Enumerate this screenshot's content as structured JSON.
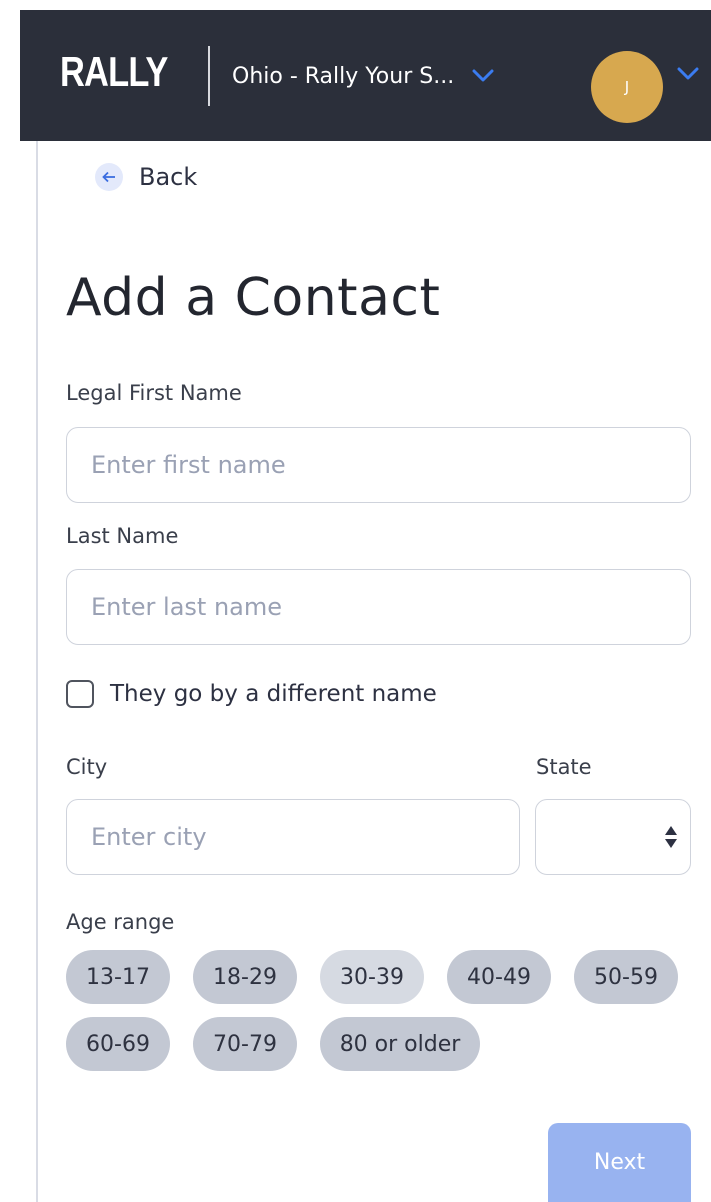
{
  "header": {
    "logo": "RALLY",
    "org_name": "Ohio - Rally Your S...",
    "avatar_initial": "J"
  },
  "nav": {
    "back_label": "Back"
  },
  "page": {
    "title": "Add a Contact"
  },
  "form": {
    "first_name": {
      "label": "Legal First Name",
      "placeholder": "Enter first name",
      "value": ""
    },
    "last_name": {
      "label": "Last Name",
      "placeholder": "Enter last name",
      "value": ""
    },
    "different_name_label": "They go by a different name",
    "city": {
      "label": "City",
      "placeholder": "Enter city",
      "value": ""
    },
    "state": {
      "label": "State",
      "value": ""
    },
    "age_range": {
      "label": "Age range",
      "options": [
        "13-17",
        "18-29",
        "30-39",
        "40-49",
        "50-59",
        "60-69",
        "70-79",
        "80 or older"
      ]
    },
    "next_label": "Next"
  },
  "colors": {
    "header_bg": "#2b2f3a",
    "accent_blue": "#3b6de0",
    "avatar_bg": "#d7a84f",
    "chip_bg": "#c3c8d3",
    "next_disabled": "#98b3f0"
  },
  "icons": {
    "back": "arrow-left-icon",
    "org_dropdown": "chevron-down-icon",
    "avatar_dropdown": "chevron-down-icon",
    "checkbox": "checkbox-unchecked-icon",
    "state_select": "sort-arrows-icon"
  }
}
